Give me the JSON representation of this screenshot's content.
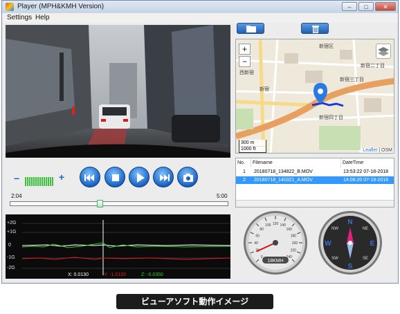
{
  "window": {
    "title": "Player (MPH&KMH Version)"
  },
  "menu": {
    "items": [
      "Settings",
      "Help"
    ]
  },
  "map": {
    "zoom_in": "+",
    "zoom_out": "−",
    "scale_m": "300 m",
    "scale_ft": "1000 ft",
    "attribution": {
      "leaflet": "Leaflet",
      "separator": "|",
      "osm": "OSM"
    },
    "labels": [
      "新宿区",
      "新宿四丁目",
      "新宿二丁目",
      "新宿",
      "新宿三丁目",
      "西新宿"
    ]
  },
  "player": {
    "volume_minus": "−",
    "volume_plus": "+",
    "volume_level": 1.0,
    "time_current": "2:04",
    "time_total": "5:00",
    "seek_position": 0.41
  },
  "graph": {
    "labels": [
      "+2G",
      "+1G",
      "0",
      "-1G",
      "-2G"
    ],
    "x_readout": "X: 0.0130",
    "y_readout": "Y: -1.0120",
    "z_readout": "Z: -0.0350",
    "colors": {
      "x": "#ffffff",
      "y": "#e02020",
      "z": "#30d030"
    }
  },
  "file_table": {
    "columns": [
      "No.",
      "Filename",
      "DateTime"
    ],
    "rows": [
      {
        "no": "1",
        "filename": "20180718_134822_B.MOV",
        "datetime": "13:53:22 07-18-2018"
      },
      {
        "no": "2",
        "filename": "20180718_140321_A.MOV",
        "datetime": "14:08:20 07-18-2018"
      }
    ],
    "selected_row": 2
  },
  "speedometer": {
    "unit": "18KMH",
    "speed": 18,
    "ticks": [
      "0",
      "20",
      "40",
      "60",
      "80",
      "100",
      "120",
      "140",
      "160",
      "180",
      "200",
      "220",
      "240"
    ]
  },
  "compass": {
    "directions": [
      "N",
      "E",
      "S",
      "W",
      "NE",
      "SE",
      "SW",
      "NW"
    ]
  },
  "caption": "ビューアソフト動作イメージ"
}
